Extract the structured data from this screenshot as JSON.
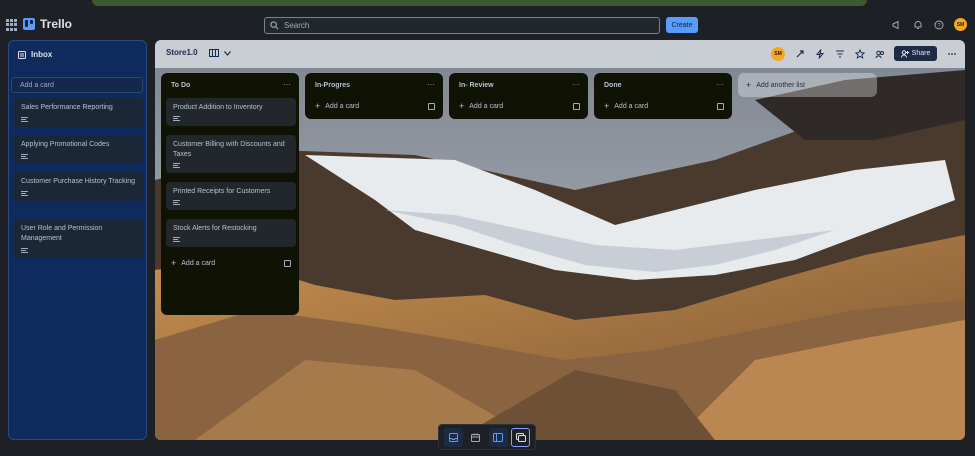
{
  "app": {
    "name": "Trello"
  },
  "search": {
    "placeholder": "Search"
  },
  "header": {
    "create_label": "Create",
    "user_initials": "SM"
  },
  "inbox": {
    "title": "Inbox",
    "add_placeholder": "Add a card",
    "cards": [
      {
        "title": "Sales Performance Reporting"
      },
      {
        "title": "Applying Promotional Codes"
      },
      {
        "title": "Customer Purchase History Tracking"
      },
      {
        "title": "User Role and Permission Management"
      }
    ]
  },
  "board": {
    "title": "Store1.0",
    "member_initials": "SM",
    "share_label": "Share",
    "add_list_label": "Add another list",
    "lists": [
      {
        "name": "To Do",
        "cards": [
          {
            "title": "Product Addition to Inventory"
          },
          {
            "title": "Customer Billing with Discounts and Taxes"
          },
          {
            "title": "Printed Receipts for Customers"
          },
          {
            "title": "Stock Alerts for Restocking"
          }
        ],
        "add_card_label": "Add a card"
      },
      {
        "name": "In-Progres",
        "cards": [],
        "add_card_label": "Add a card"
      },
      {
        "name": "In- Review",
        "cards": [],
        "add_card_label": "Add a card"
      },
      {
        "name": "Done",
        "cards": [],
        "add_card_label": "Add a card"
      }
    ]
  },
  "colors": {
    "accent": "#579dff",
    "inbox_bg": "#0f2a5c",
    "list_bg": "#101204"
  }
}
